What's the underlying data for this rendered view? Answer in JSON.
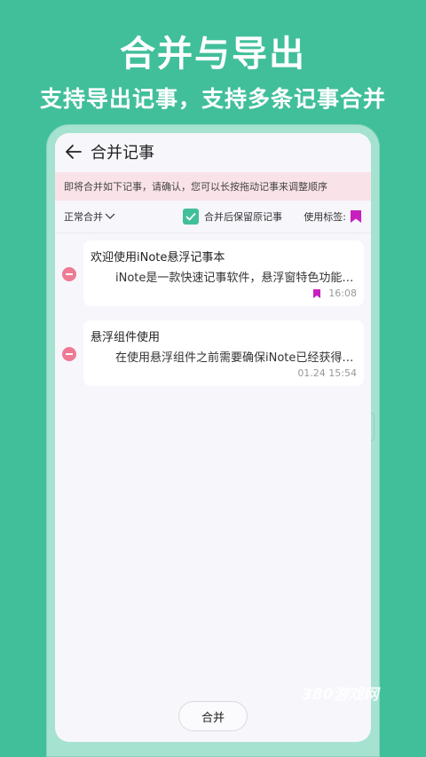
{
  "promo": {
    "title": "合并与导出",
    "subtitle": "支持导出记事，支持多条记事合并"
  },
  "header": {
    "title": "合并记事"
  },
  "notice": "即将合并如下记事，请确认，您可以长按拖动记事来调整顺序",
  "options": {
    "mode_label": "正常合并",
    "keep_label": "合并后保留原记事",
    "keep_checked": true,
    "tag_label": "使用标签:",
    "accent_color": "#41bf9b",
    "tag_color": "#c81fbf"
  },
  "notes": [
    {
      "title": "欢迎使用iNote悬浮记事本",
      "content": "iNote是一款快速记事软件，悬浮窗特色功能，随时随地快速记录",
      "time": "16:08",
      "has_tag": true
    },
    {
      "title": "悬浮组件使用",
      "content": "在使用悬浮组件之前需要确保iNote已经获得悬浮窗权限",
      "time": "01.24 15:54",
      "has_tag": false
    }
  ],
  "merge_button": "合并",
  "watermark": "380游戏网"
}
